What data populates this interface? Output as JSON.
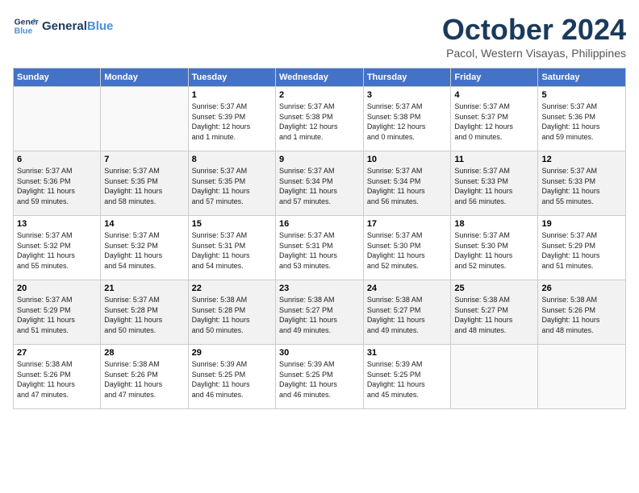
{
  "logo": {
    "line1": "General",
    "line2": "Blue"
  },
  "title": "October 2024",
  "location": "Pacol, Western Visayas, Philippines",
  "header_days": [
    "Sunday",
    "Monday",
    "Tuesday",
    "Wednesday",
    "Thursday",
    "Friday",
    "Saturday"
  ],
  "weeks": [
    [
      {
        "day": "",
        "info": ""
      },
      {
        "day": "",
        "info": ""
      },
      {
        "day": "1",
        "info": "Sunrise: 5:37 AM\nSunset: 5:39 PM\nDaylight: 12 hours\nand 1 minute."
      },
      {
        "day": "2",
        "info": "Sunrise: 5:37 AM\nSunset: 5:38 PM\nDaylight: 12 hours\nand 1 minute."
      },
      {
        "day": "3",
        "info": "Sunrise: 5:37 AM\nSunset: 5:38 PM\nDaylight: 12 hours\nand 0 minutes."
      },
      {
        "day": "4",
        "info": "Sunrise: 5:37 AM\nSunset: 5:37 PM\nDaylight: 12 hours\nand 0 minutes."
      },
      {
        "day": "5",
        "info": "Sunrise: 5:37 AM\nSunset: 5:36 PM\nDaylight: 11 hours\nand 59 minutes."
      }
    ],
    [
      {
        "day": "6",
        "info": "Sunrise: 5:37 AM\nSunset: 5:36 PM\nDaylight: 11 hours\nand 59 minutes."
      },
      {
        "day": "7",
        "info": "Sunrise: 5:37 AM\nSunset: 5:35 PM\nDaylight: 11 hours\nand 58 minutes."
      },
      {
        "day": "8",
        "info": "Sunrise: 5:37 AM\nSunset: 5:35 PM\nDaylight: 11 hours\nand 57 minutes."
      },
      {
        "day": "9",
        "info": "Sunrise: 5:37 AM\nSunset: 5:34 PM\nDaylight: 11 hours\nand 57 minutes."
      },
      {
        "day": "10",
        "info": "Sunrise: 5:37 AM\nSunset: 5:34 PM\nDaylight: 11 hours\nand 56 minutes."
      },
      {
        "day": "11",
        "info": "Sunrise: 5:37 AM\nSunset: 5:33 PM\nDaylight: 11 hours\nand 56 minutes."
      },
      {
        "day": "12",
        "info": "Sunrise: 5:37 AM\nSunset: 5:33 PM\nDaylight: 11 hours\nand 55 minutes."
      }
    ],
    [
      {
        "day": "13",
        "info": "Sunrise: 5:37 AM\nSunset: 5:32 PM\nDaylight: 11 hours\nand 55 minutes."
      },
      {
        "day": "14",
        "info": "Sunrise: 5:37 AM\nSunset: 5:32 PM\nDaylight: 11 hours\nand 54 minutes."
      },
      {
        "day": "15",
        "info": "Sunrise: 5:37 AM\nSunset: 5:31 PM\nDaylight: 11 hours\nand 54 minutes."
      },
      {
        "day": "16",
        "info": "Sunrise: 5:37 AM\nSunset: 5:31 PM\nDaylight: 11 hours\nand 53 minutes."
      },
      {
        "day": "17",
        "info": "Sunrise: 5:37 AM\nSunset: 5:30 PM\nDaylight: 11 hours\nand 52 minutes."
      },
      {
        "day": "18",
        "info": "Sunrise: 5:37 AM\nSunset: 5:30 PM\nDaylight: 11 hours\nand 52 minutes."
      },
      {
        "day": "19",
        "info": "Sunrise: 5:37 AM\nSunset: 5:29 PM\nDaylight: 11 hours\nand 51 minutes."
      }
    ],
    [
      {
        "day": "20",
        "info": "Sunrise: 5:37 AM\nSunset: 5:29 PM\nDaylight: 11 hours\nand 51 minutes."
      },
      {
        "day": "21",
        "info": "Sunrise: 5:37 AM\nSunset: 5:28 PM\nDaylight: 11 hours\nand 50 minutes."
      },
      {
        "day": "22",
        "info": "Sunrise: 5:38 AM\nSunset: 5:28 PM\nDaylight: 11 hours\nand 50 minutes."
      },
      {
        "day": "23",
        "info": "Sunrise: 5:38 AM\nSunset: 5:27 PM\nDaylight: 11 hours\nand 49 minutes."
      },
      {
        "day": "24",
        "info": "Sunrise: 5:38 AM\nSunset: 5:27 PM\nDaylight: 11 hours\nand 49 minutes."
      },
      {
        "day": "25",
        "info": "Sunrise: 5:38 AM\nSunset: 5:27 PM\nDaylight: 11 hours\nand 48 minutes."
      },
      {
        "day": "26",
        "info": "Sunrise: 5:38 AM\nSunset: 5:26 PM\nDaylight: 11 hours\nand 48 minutes."
      }
    ],
    [
      {
        "day": "27",
        "info": "Sunrise: 5:38 AM\nSunset: 5:26 PM\nDaylight: 11 hours\nand 47 minutes."
      },
      {
        "day": "28",
        "info": "Sunrise: 5:38 AM\nSunset: 5:26 PM\nDaylight: 11 hours\nand 47 minutes."
      },
      {
        "day": "29",
        "info": "Sunrise: 5:39 AM\nSunset: 5:25 PM\nDaylight: 11 hours\nand 46 minutes."
      },
      {
        "day": "30",
        "info": "Sunrise: 5:39 AM\nSunset: 5:25 PM\nDaylight: 11 hours\nand 46 minutes."
      },
      {
        "day": "31",
        "info": "Sunrise: 5:39 AM\nSunset: 5:25 PM\nDaylight: 11 hours\nand 45 minutes."
      },
      {
        "day": "",
        "info": ""
      },
      {
        "day": "",
        "info": ""
      }
    ]
  ]
}
